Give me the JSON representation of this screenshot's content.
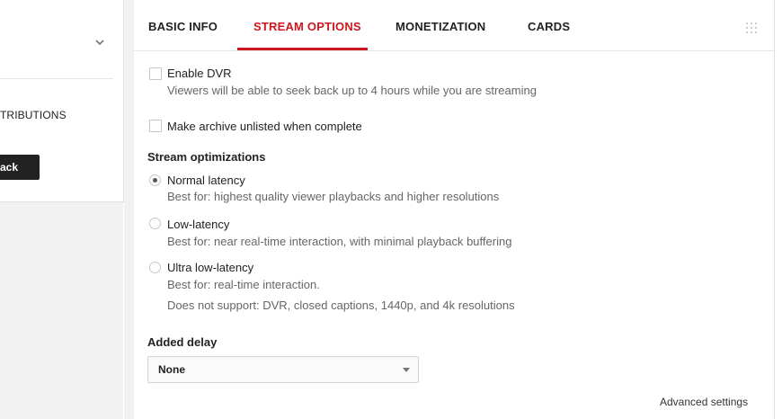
{
  "left_panel": {
    "contributions_label": "TRIBUTIONS",
    "button_label": "ack"
  },
  "tabs": [
    {
      "label": "BASIC INFO"
    },
    {
      "label": "STREAM OPTIONS",
      "active": true
    },
    {
      "label": "MONETIZATION"
    },
    {
      "label": "CARDS"
    }
  ],
  "options": {
    "enable_dvr": {
      "label": "Enable DVR",
      "description": "Viewers will be able to seek back up to 4 hours while you are streaming",
      "checked": false
    },
    "archive_unlisted": {
      "label": "Make archive unlisted when complete",
      "checked": false
    }
  },
  "stream_optimizations": {
    "heading": "Stream optimizations",
    "choices": [
      {
        "label": "Normal latency",
        "description": "Best for: highest quality viewer playbacks and higher resolutions",
        "selected": true
      },
      {
        "label": "Low-latency",
        "description": "Best for: near real-time interaction, with minimal playback buffering",
        "selected": false
      },
      {
        "label": "Ultra low-latency",
        "description": "Best for: real-time interaction.",
        "note": "Does not support: DVR, closed captions, 1440p, and 4k resolutions",
        "selected": false
      }
    ]
  },
  "added_delay": {
    "heading": "Added delay",
    "selected_value": "None"
  },
  "advanced_settings_label": "Advanced settings",
  "colors": {
    "accent": "#cc181e",
    "background": "#f1f1f1"
  }
}
